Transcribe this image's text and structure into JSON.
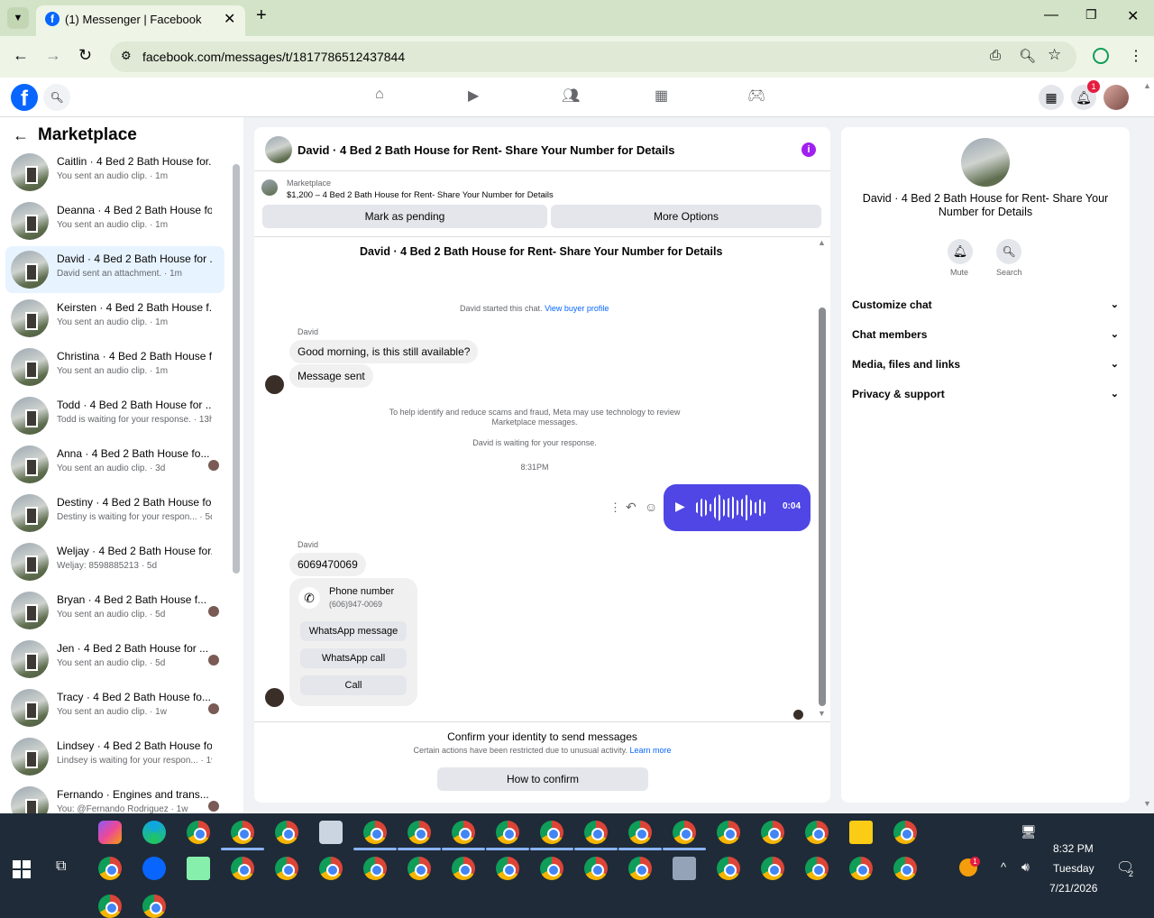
{
  "browser": {
    "tab_title": "(1) Messenger | Facebook",
    "url": "facebook.com/messages/t/1817786512437844"
  },
  "header": {
    "notification_count": "1"
  },
  "sidebar": {
    "title": "Marketplace",
    "items": [
      {
        "name": "Caitlin · 4 Bed 2 Bath House for...",
        "snippet": "You sent an audio clip. · 1m"
      },
      {
        "name": "Deanna · 4 Bed 2 Bath House fo...",
        "snippet": "You sent an audio clip. · 1m"
      },
      {
        "name": "David · 4 Bed 2 Bath House for ...",
        "snippet": "David sent an attachment. · 1m"
      },
      {
        "name": "Keirsten · 4 Bed 2 Bath House f...",
        "snippet": "You sent an audio clip. · 1m"
      },
      {
        "name": "Christina · 4 Bed 2 Bath House f...",
        "snippet": "You sent an audio clip. · 1m"
      },
      {
        "name": "Todd · 4 Bed 2 Bath House for ...",
        "snippet": "Todd is waiting for your response. · 13h"
      },
      {
        "name": "Anna · 4 Bed 2 Bath House fo...",
        "snippet": "You sent an audio clip. · 3d"
      },
      {
        "name": "Destiny · 4 Bed 2 Bath House fo...",
        "snippet": "Destiny is waiting for your respon... · 5d"
      },
      {
        "name": "Weljay · 4 Bed 2 Bath House for...",
        "snippet": "Weljay: 8598885213 · 5d"
      },
      {
        "name": "Bryan · 4 Bed 2 Bath House f...",
        "snippet": "You sent an audio clip. · 5d"
      },
      {
        "name": "Jen · 4 Bed 2 Bath House for ...",
        "snippet": "You sent an audio clip. · 5d"
      },
      {
        "name": "Tracy · 4 Bed 2 Bath House fo...",
        "snippet": "You sent an audio clip. · 1w"
      },
      {
        "name": "Lindsey · 4 Bed 2 Bath House fo...",
        "snippet": "Lindsey is waiting for your respon... · 1w"
      },
      {
        "name": "Fernando · Engines and trans...",
        "snippet": "You: @Fernando Rodriguez · 1w"
      }
    ]
  },
  "chat": {
    "title": "David · 4 Bed 2 Bath House for Rent- Share Your Number for Details",
    "listing_source": "Marketplace",
    "listing": "$1,200 – 4 Bed 2 Bath House for Rent- Share Your Number for Details",
    "mark_pending": "Mark as pending",
    "more_options": "More Options",
    "heading": "David · 4 Bed 2 Bath House for Rent- Share Your Number for Details",
    "started": "David started this chat.",
    "view_profile": "View buyer profile",
    "sender1": "David",
    "msg1": "Good morning, is this still available?",
    "msg2": "Message sent",
    "notice": "To help identify and reduce scams and fraud, Meta may use technology to review Marketplace messages.",
    "waiting": "David is waiting for your response.",
    "time": "8:31PM",
    "audio_duration": "0:04",
    "sender2": "David",
    "msg3": "6069470069",
    "phone_title": "Phone number",
    "phone_number": "(606)947-0069",
    "whatsapp_msg": "WhatsApp message",
    "whatsapp_call": "WhatsApp call",
    "call": "Call",
    "confirm_title": "Confirm your identity to send messages",
    "confirm_text": "Certain actions have been restricted due to unusual activity.",
    "learn_more": "Learn more",
    "how_confirm": "How to confirm"
  },
  "info": {
    "title": "David · 4 Bed 2 Bath House for Rent- Share Your Number for Details",
    "mute": "Mute",
    "search": "Search",
    "sections": [
      "Customize chat",
      "Chat members",
      "Media, files and links",
      "Privacy & support"
    ]
  },
  "taskbar": {
    "time": "8:32 PM",
    "day": "Tuesday",
    "date": "7/21/2026",
    "notif": "2",
    "badge": "1"
  },
  "colors": {
    "accent": "#0866ff",
    "bubble_blue": "#4f46e5",
    "purple_info": "#a020f0"
  }
}
